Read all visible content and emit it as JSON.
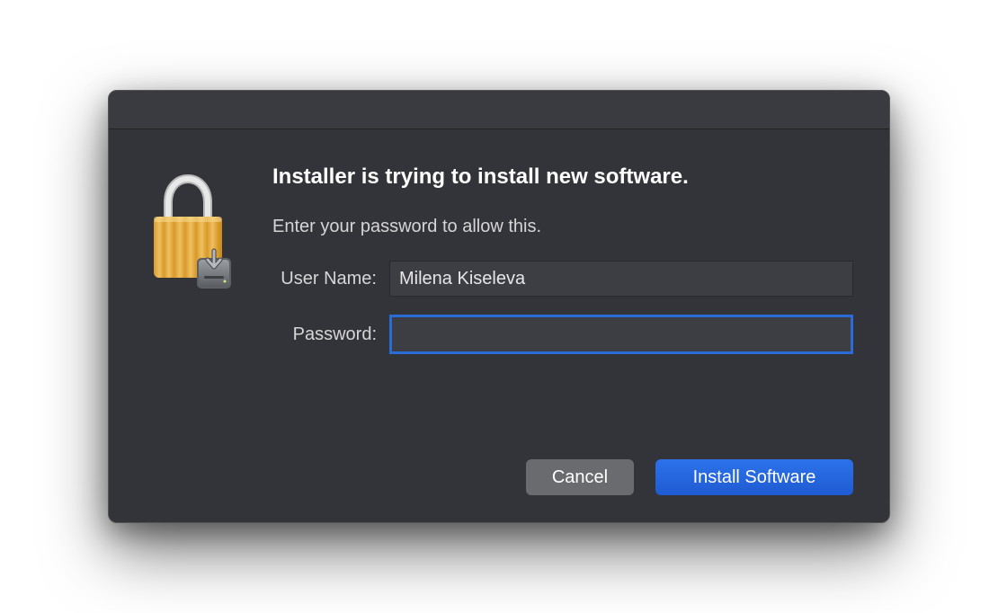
{
  "dialog": {
    "heading": "Installer is trying to install new software.",
    "subtext": "Enter your password to allow this.",
    "username_label": "User Name:",
    "password_label": "Password:",
    "username_value": "Milena Kiseleva",
    "password_value": "",
    "cancel_label": "Cancel",
    "confirm_label": "Install Software"
  },
  "icon": {
    "name": "lock-with-drive-icon"
  },
  "colors": {
    "dialog_bg": "#33343a",
    "primary_button": "#2160dc",
    "focus_ring": "#2a6bd6"
  }
}
